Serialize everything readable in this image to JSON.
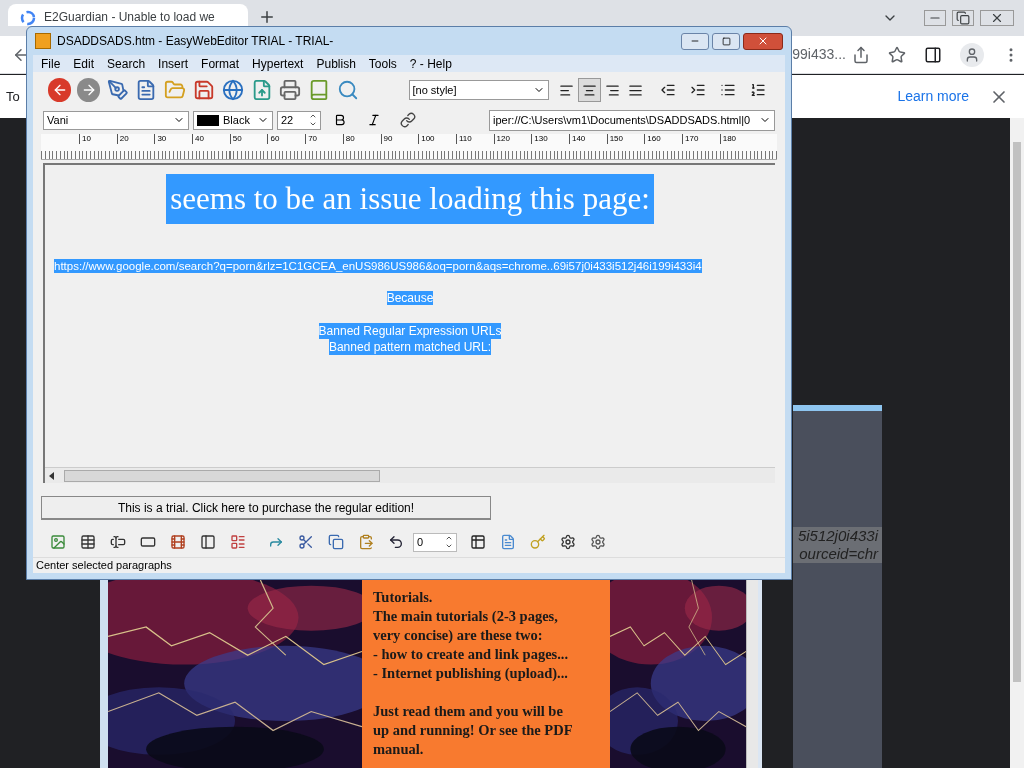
{
  "browser": {
    "tab": {
      "title": "E2Guardian - Unable to load we"
    },
    "address_fragment": "99i433...",
    "infobar": {
      "text": "To",
      "link": "Learn more"
    }
  },
  "background_page": {
    "url_fragments": [
      "5i512j0i433i",
      "ourceid=chr"
    ]
  },
  "help_window": {
    "paragraphs": [
      [
        "Tutorials.",
        "The main tutorials (2-3 pages, very concise) are these two:",
        "- how to create and link pages...",
        "- Internet publishing (upload)..."
      ],
      [
        "Just read them and you will be up and running! Or see the PDF manual."
      ]
    ]
  },
  "editor": {
    "title": "DSADDSADS.htm - EasyWebEditor TRIAL - TRIAL-",
    "menu": [
      "File",
      "Edit",
      "Search",
      "Insert",
      "Format",
      "Hypertext",
      "Publish",
      "Tools",
      "? - Help"
    ],
    "style_select": "[no style]",
    "align_buttons": [
      {
        "kind": "left",
        "selected": false
      },
      {
        "kind": "center",
        "selected": true
      },
      {
        "kind": "right",
        "selected": false
      },
      {
        "kind": "justify",
        "selected": false
      }
    ],
    "font": "Vani",
    "color": {
      "label": "Black",
      "color": "#000000"
    },
    "size": "22",
    "path": "iper://C:\\Users\\vm1\\Documents\\DSADDSADS.html|0",
    "ruler": [
      "10",
      "20",
      "30",
      "40",
      "50",
      "60",
      "70",
      "80",
      "90",
      "100",
      "110",
      "120",
      "130",
      "140",
      "150",
      "160",
      "170",
      "180"
    ],
    "document": {
      "heading": "seems to be an issue loading this page:",
      "url": "https://www.google.com/search?q=porn&rlz=1C1GCEA_enUS986US986&oq=porn&aqs=chrome..69i57j0i433i512j46i199i433i4",
      "because": "Because",
      "reasons": [
        "Banned Regular Expression URLs",
        "Banned pattern matched URL:"
      ]
    },
    "trial_button": "This is a trial. Click here to purchase the regular edition!",
    "undo_count": "0",
    "status": "Center selected paragraphs"
  }
}
